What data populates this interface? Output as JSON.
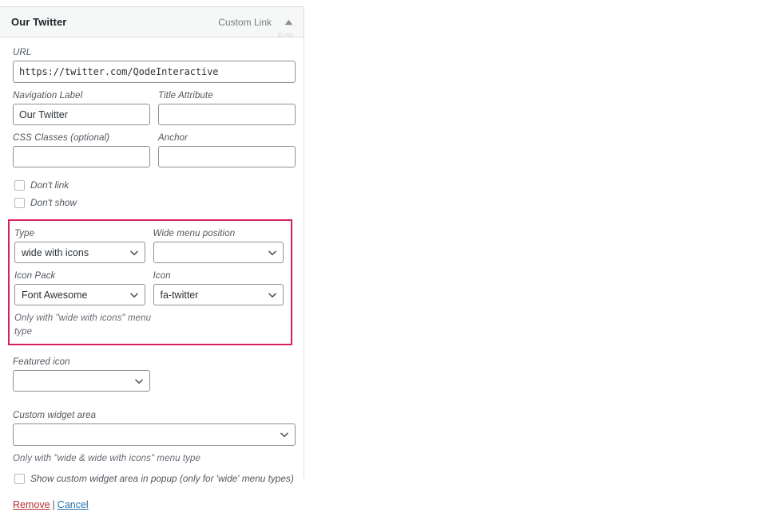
{
  "panel": {
    "header": {
      "title": "Our Twitter",
      "type_label": "Custom Link",
      "toggle_icon": "chevron-up-icon",
      "edit_ghost_text": "Edit"
    },
    "fields": {
      "url": {
        "label": "URL",
        "value": "https://twitter.com/QodeInteractive",
        "placeholder": ""
      },
      "navigation_label": {
        "label": "Navigation Label",
        "value": "Our Twitter",
        "placeholder": ""
      },
      "title_attribute": {
        "label": "Title Attribute",
        "value": "",
        "placeholder": ""
      },
      "css_classes": {
        "label": "CSS Classes (optional)",
        "value": "",
        "placeholder": ""
      },
      "anchor": {
        "label": "Anchor",
        "value": "",
        "placeholder": ""
      },
      "dont_link": {
        "label": "Don't link",
        "checked": false
      },
      "dont_show": {
        "label": "Don't show",
        "checked": false
      }
    },
    "highlighted_group": {
      "accent_color": "#d6215a",
      "type": {
        "label": "Type",
        "value": "wide with icons"
      },
      "wide_menu_position": {
        "label": "Wide menu position",
        "value": ""
      },
      "icon_pack": {
        "label": "Icon Pack",
        "value": "Font Awesome"
      },
      "icon": {
        "label": "Icon",
        "value": "fa-twitter"
      },
      "help_text": "Only with \"wide with icons\" menu type"
    },
    "featured_icon": {
      "label": "Featured icon",
      "value": ""
    },
    "custom_widget_area": {
      "label": "Custom widget area",
      "value": "",
      "help_text": "Only with \"wide & wide with icons\" menu type"
    },
    "show_widget_popup": {
      "label": "Show custom widget area in popup (only for 'wide' menu types)",
      "checked": false
    },
    "actions": {
      "remove_label": "Remove",
      "separator": "|",
      "cancel_label": "Cancel",
      "remove_color": "#b32d2e",
      "cancel_color": "#2271b1"
    }
  }
}
